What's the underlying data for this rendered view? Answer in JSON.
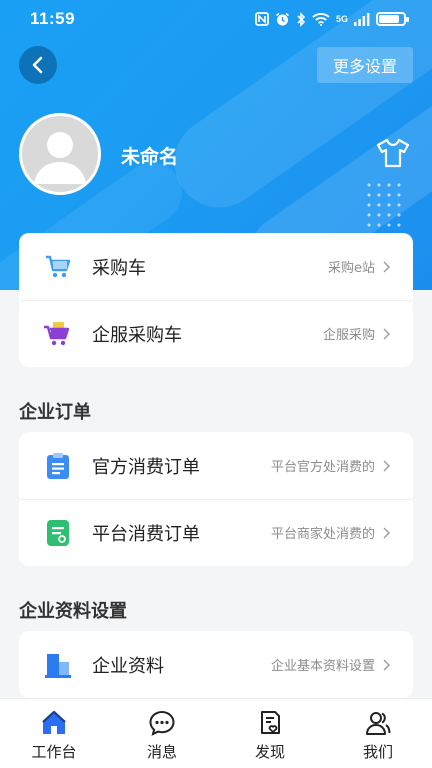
{
  "status_bar": {
    "time": "11:59",
    "network": "5G",
    "battery_level": 0.85
  },
  "header": {
    "more_settings_label": "更多设置",
    "username": "未命名"
  },
  "cart_card": {
    "items": [
      {
        "label": "采购车",
        "hint": "采购e站",
        "icon": "shopping-cart-icon"
      },
      {
        "label": "企服采购车",
        "hint": "企服采购",
        "icon": "service-cart-icon"
      }
    ]
  },
  "orders_section": {
    "title": "企业订单",
    "items": [
      {
        "label": "官方消费订单",
        "hint": "平台官方处消费的",
        "icon": "clipboard-icon"
      },
      {
        "label": "平台消费订单",
        "hint": "平台商家处消费的",
        "icon": "receipt-icon"
      }
    ]
  },
  "settings_section": {
    "title": "企业资料设置",
    "items": [
      {
        "label": "企业资料",
        "hint": "企业基本资料设置",
        "icon": "building-icon"
      }
    ]
  },
  "tabbar": {
    "tabs": [
      {
        "label": "工作台",
        "icon": "home-icon",
        "active": true
      },
      {
        "label": "消息",
        "icon": "chat-icon",
        "active": false
      },
      {
        "label": "发现",
        "icon": "discover-icon",
        "active": false
      },
      {
        "label": "我们",
        "icon": "users-icon",
        "active": false
      }
    ]
  },
  "colors": {
    "brand_blue": "#1b9cf2",
    "cart_blue": "#3e9df1",
    "service_purple": "#8b3fd6",
    "service_yellow": "#f5c842",
    "clipboard_blue": "#3b8df2",
    "receipt_green": "#2fbf71",
    "tab_active": "#2a6ff3"
  }
}
